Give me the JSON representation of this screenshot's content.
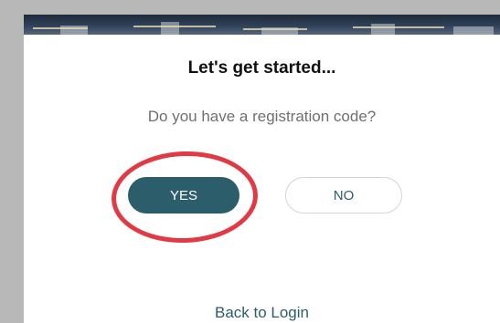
{
  "screen": {
    "title": "Let's get started...",
    "question": "Do you have a registration code?",
    "yes_label": "YES",
    "no_label": "NO",
    "back_link": "Back to Login"
  },
  "colors": {
    "primary": "#2c5d6a",
    "annotation": "#e23a44",
    "subtitle_text": "#6f6f6f"
  }
}
